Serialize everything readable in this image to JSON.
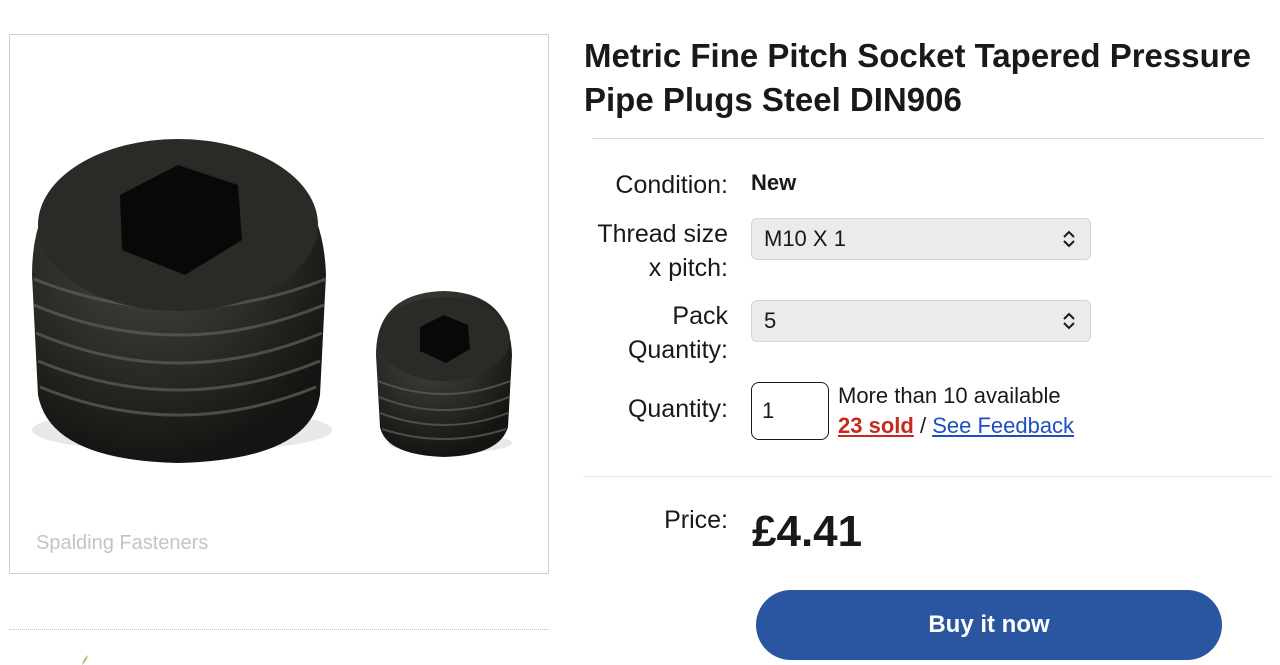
{
  "gallery": {
    "watermark": "Spalding Fasteners"
  },
  "product": {
    "title": "Metric Fine Pitch Socket Tapered Pressure Pipe Plugs Steel DIN906",
    "condition_label": "Condition:",
    "condition_value": "New",
    "thread_label_line1": "Thread size",
    "thread_label_line2": "x pitch:",
    "thread_value": "M10 X 1",
    "pack_label_line1": "Pack",
    "pack_label_line2": "Quantity:",
    "pack_value": "5",
    "quantity_label": "Quantity:",
    "quantity_value": "1",
    "availability": "More than 10 available",
    "sold": "23 sold",
    "separator": "/",
    "feedback": "See Feedback",
    "price_label": "Price:",
    "price": "£4.41",
    "buy_label": "Buy it now"
  },
  "colors": {
    "accent": "#2a55a1",
    "sold": "#c7291f",
    "link": "#1e4fc2"
  },
  "icons": {
    "select_chevron": "chevron-up-down-icon"
  }
}
